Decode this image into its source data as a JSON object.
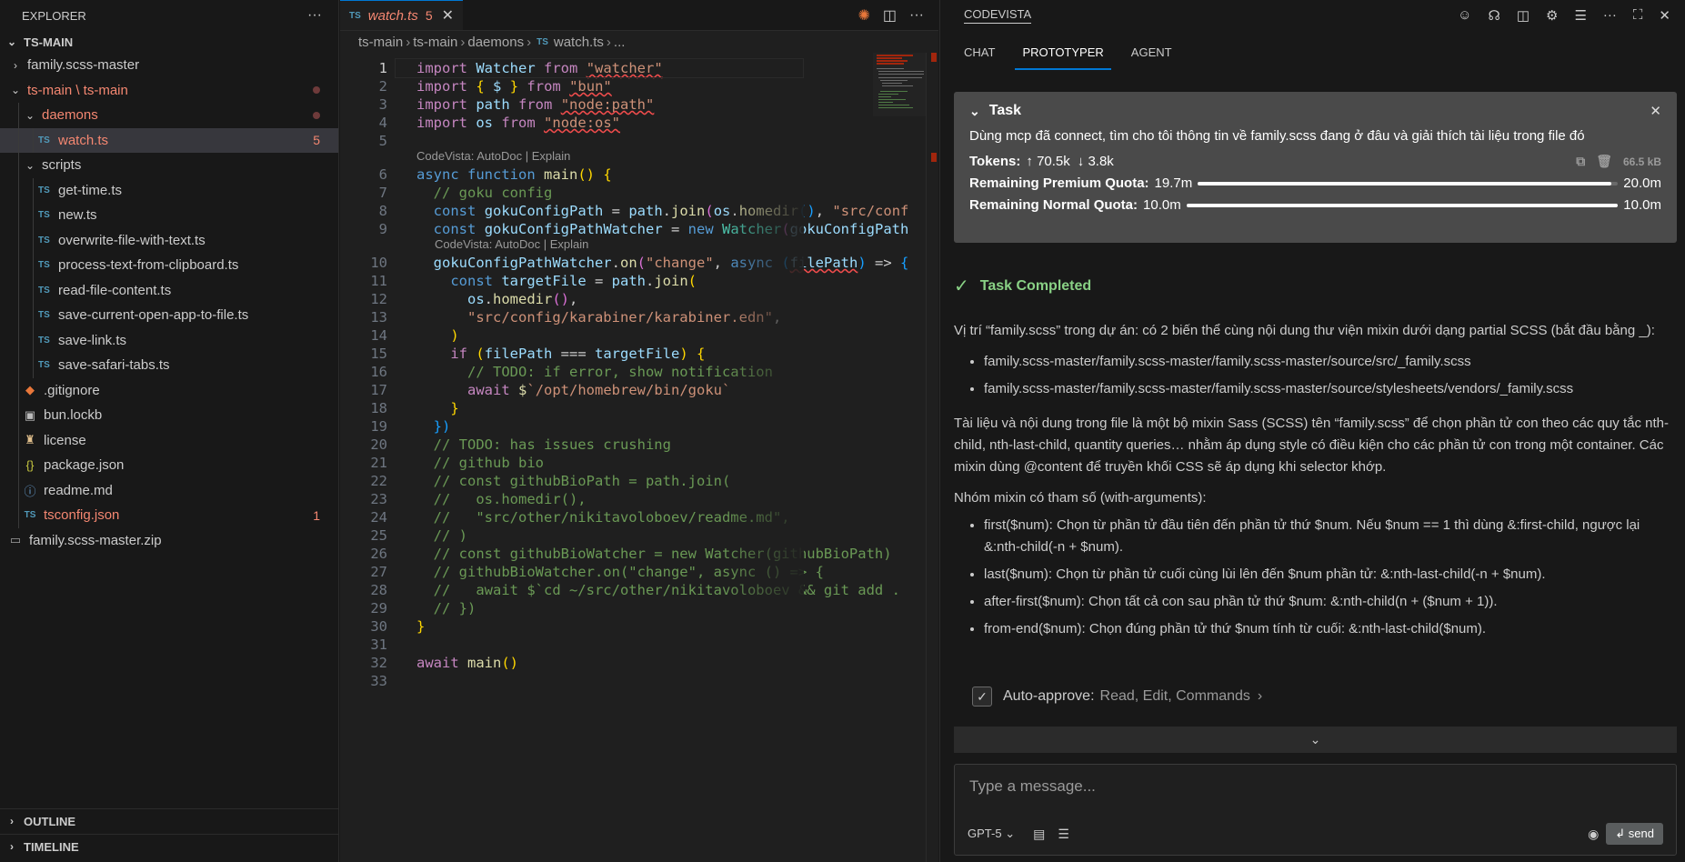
{
  "explorer": {
    "title": "EXPLORER",
    "more": "···",
    "root": "TS-MAIN",
    "items": [
      {
        "label": "family.scss-master",
        "kind": "folder",
        "open": false,
        "depth": 1
      },
      {
        "label": "ts-main \\ ts-main",
        "kind": "folder",
        "open": true,
        "depth": 1,
        "modified": true
      },
      {
        "label": "daemons",
        "kind": "folder",
        "open": true,
        "depth": 2,
        "modified": true
      },
      {
        "label": "watch.ts",
        "kind": "ts",
        "depth": 3,
        "selected": true,
        "errors": "5"
      },
      {
        "label": "scripts",
        "kind": "folder",
        "open": true,
        "depth": 2
      },
      {
        "label": "get-time.ts",
        "kind": "ts",
        "depth": 3
      },
      {
        "label": "new.ts",
        "kind": "ts",
        "depth": 3
      },
      {
        "label": "overwrite-file-with-text.ts",
        "kind": "ts",
        "depth": 3
      },
      {
        "label": "process-text-from-clipboard.ts",
        "kind": "ts",
        "depth": 3
      },
      {
        "label": "read-file-content.ts",
        "kind": "ts",
        "depth": 3
      },
      {
        "label": "save-current-open-app-to-file.ts",
        "kind": "ts",
        "depth": 3
      },
      {
        "label": "save-link.ts",
        "kind": "ts",
        "depth": 3
      },
      {
        "label": "save-safari-tabs.ts",
        "kind": "ts",
        "depth": 3
      },
      {
        "label": ".gitignore",
        "kind": "gitignore",
        "depth": 2
      },
      {
        "label": "bun.lockb",
        "kind": "lock",
        "depth": 2
      },
      {
        "label": "license",
        "kind": "license",
        "depth": 2
      },
      {
        "label": "package.json",
        "kind": "json",
        "depth": 2
      },
      {
        "label": "readme.md",
        "kind": "info",
        "depth": 2
      },
      {
        "label": "tsconfig.json",
        "kind": "tsconfig",
        "depth": 2,
        "errors": "1"
      },
      {
        "label": "family.scss-master.zip",
        "kind": "zip",
        "depth": 1
      }
    ],
    "outline": "OUTLINE",
    "timeline": "TIMELINE"
  },
  "editor": {
    "tab": {
      "label": "watch.ts",
      "badge": "TS",
      "problems": "5"
    },
    "breadcrumb": [
      "ts-main",
      "ts-main",
      "daemons",
      "watch.ts",
      "..."
    ],
    "codelens": "CodeVista: AutoDoc | Explain",
    "line_numbers": [
      "1",
      "2",
      "3",
      "4",
      "5",
      "6",
      "7",
      "8",
      "9",
      "10",
      "11",
      "12",
      "13",
      "14",
      "15",
      "16",
      "17",
      "18",
      "19",
      "20",
      "21",
      "22",
      "23",
      "24",
      "25",
      "26",
      "27",
      "28",
      "29",
      "30",
      "31",
      "32",
      "33"
    ]
  },
  "chat": {
    "header": "CODEVISTA",
    "tabs": [
      "CHAT",
      "PROTOTYPER",
      "AGENT"
    ],
    "active_tab": "PROTOTYPER",
    "task": {
      "title": "Task",
      "text": "Dùng mcp đã connect, tìm cho tôi thông tin về family.scss đang ở đâu và giải thích tài liệu trong file đó",
      "tokens_label": "Tokens:",
      "tokens_up": "↑ 70.5k",
      "tokens_down": "↓ 3.8k",
      "size": "66.5 kB",
      "premium_label": "Remaining Premium Quota:",
      "premium_value": "19.7m",
      "premium_max": "20.0m",
      "premium_ratio": 0.985,
      "normal_label": "Remaining Normal Quota:",
      "normal_value": "10.0m",
      "normal_max": "10.0m",
      "normal_ratio": 1.0
    },
    "completed": "Task Completed",
    "result": {
      "p1": "Vị trí “family.scss” trong dự án: có 2 biến thể cùng nội dung thư viện mixin dưới dạng partial SCSS (bắt đầu bằng _):",
      "paths": [
        "family.scss-master/family.scss-master/family.scss-master/source/src/_family.scss",
        "family.scss-master/family.scss-master/family.scss-master/source/stylesheets/vendors/_family.scss"
      ],
      "p2": "Tài liệu và nội dung trong file là một bộ mixin Sass (SCSS) tên “family.scss” để chọn phần tử con theo các quy tắc nth-child, nth-last-child, quantity queries… nhằm áp dụng style có điều kiện cho các phần tử con trong một container. Các mixin dùng @content để truyền khối CSS sẽ áp dụng khi selector khớp.",
      "p3": "Nhóm mixin có tham số (with-arguments):",
      "mixins": [
        "first($num): Chọn từ phần tử đầu tiên đến phần tử thứ $num. Nếu $num == 1 thì dùng &:first-child, ngược lại &:nth-child(-n + $num).",
        "last($num): Chọn từ phần tử cuối cùng lùi lên đến $num phần tử: &:nth-last-child(-n + $num).",
        "after-first($num): Chọn tất cả con sau phần tử thứ $num: &:nth-child(n + ($num + 1)).",
        "from-end($num): Chọn đúng phần tử thứ $num tính từ cuối: &:nth-last-child($num)."
      ]
    },
    "auto_approve": {
      "label": "Auto-approve:",
      "values": "Read, Edit, Commands"
    },
    "composer": {
      "placeholder": "Type a message...",
      "model": "GPT-5",
      "send": "↲ send"
    }
  }
}
